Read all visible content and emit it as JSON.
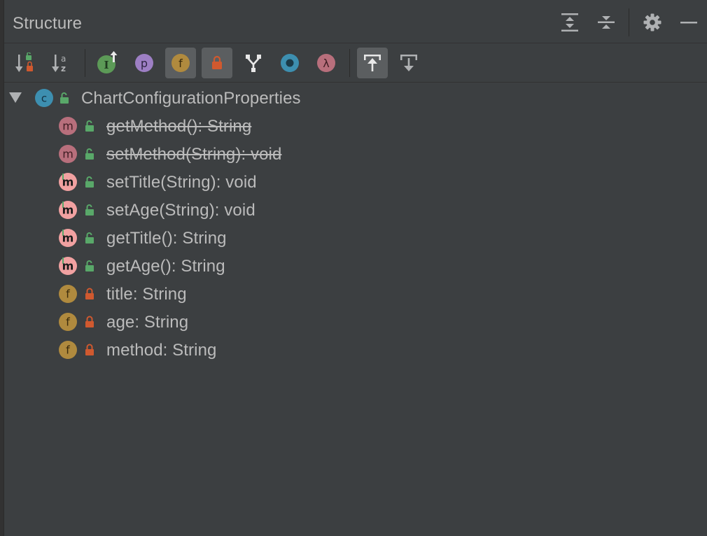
{
  "header": {
    "title": "Structure"
  },
  "toolbar": {
    "buttons": [
      {
        "name": "sort-by-visibility",
        "icon": "sort-visibility-icon",
        "active": false
      },
      {
        "name": "sort-alphabetically",
        "icon": "sort-alpha-icon",
        "active": false
      },
      {
        "name": "show-inherited",
        "icon": "interface-inherited-icon",
        "active": false
      },
      {
        "name": "show-properties",
        "icon": "property-icon",
        "active": false
      },
      {
        "name": "show-fields",
        "icon": "field-icon",
        "active": true
      },
      {
        "name": "show-non-public",
        "icon": "lock-icon",
        "active": true
      },
      {
        "name": "show-anonymous",
        "icon": "anonymous-icon",
        "active": false
      },
      {
        "name": "show-lambdas",
        "icon": "circle-icon",
        "active": false
      },
      {
        "name": "show-lambda-expressions",
        "icon": "lambda-icon",
        "active": false
      },
      {
        "name": "autoscroll-to-source",
        "icon": "autoscroll-to-icon",
        "active": true
      },
      {
        "name": "autoscroll-from-source",
        "icon": "autoscroll-from-icon",
        "active": false
      }
    ]
  },
  "tree": {
    "root": {
      "label": "ChartConfigurationProperties",
      "icon_letter": "c",
      "expanded": true
    },
    "members": [
      {
        "label": "getMethod(): String",
        "kind": "method",
        "letter": "m",
        "deprecated": true,
        "visibility": "public"
      },
      {
        "label": "setMethod(String): void",
        "kind": "method",
        "letter": "m",
        "deprecated": true,
        "visibility": "public"
      },
      {
        "label": "setTitle(String): void",
        "kind": "method-generated",
        "letter": "m",
        "deprecated": false,
        "visibility": "public"
      },
      {
        "label": "setAge(String): void",
        "kind": "method-generated",
        "letter": "m",
        "deprecated": false,
        "visibility": "public"
      },
      {
        "label": "getTitle(): String",
        "kind": "method-generated",
        "letter": "m",
        "deprecated": false,
        "visibility": "public"
      },
      {
        "label": "getAge(): String",
        "kind": "method-generated",
        "letter": "m",
        "deprecated": false,
        "visibility": "public"
      },
      {
        "label": "title: String",
        "kind": "field",
        "letter": "f",
        "deprecated": false,
        "visibility": "private"
      },
      {
        "label": "age: String",
        "kind": "field",
        "letter": "f",
        "deprecated": false,
        "visibility": "private"
      },
      {
        "label": "method: String",
        "kind": "field",
        "letter": "f",
        "deprecated": false,
        "visibility": "private"
      }
    ]
  },
  "colors": {
    "background": "#3c3f41",
    "text": "#bbbbbb",
    "class_icon": "#3d8fb0",
    "method_icon": "#b86f7c",
    "method_generated_icon": "#f1a1a1",
    "field_icon": "#b08a3e",
    "public_lock": "#59a869",
    "private_lock": "#d0592f"
  }
}
